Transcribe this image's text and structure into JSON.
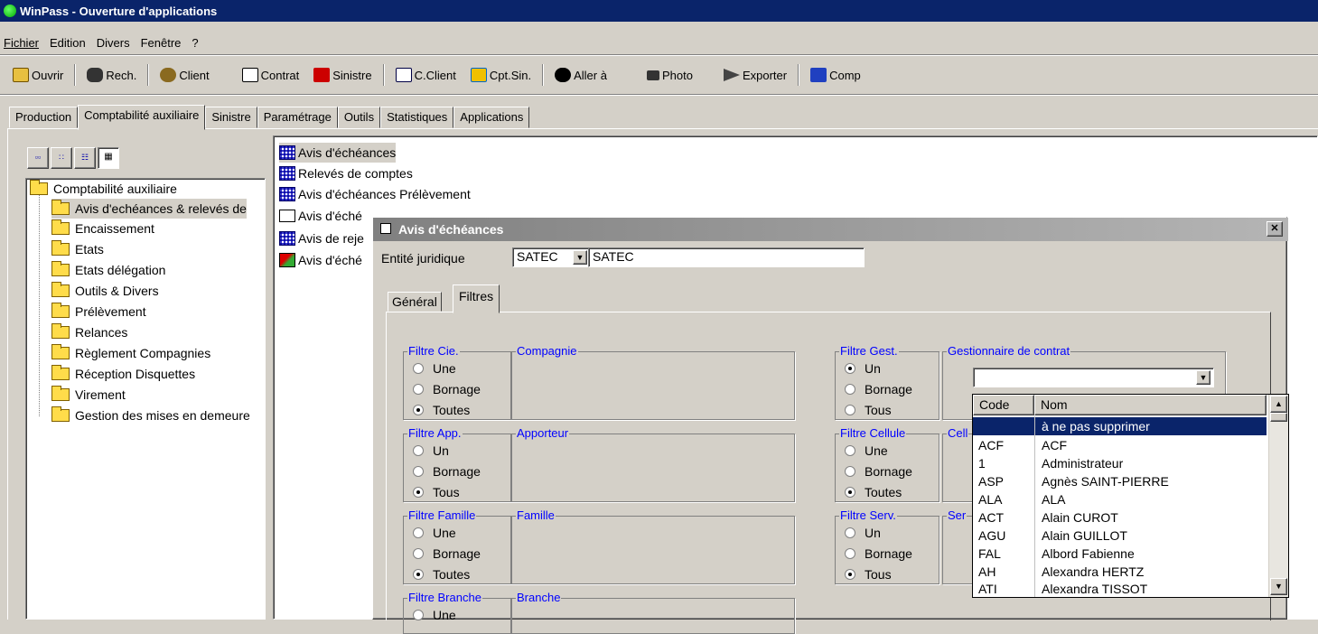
{
  "window": {
    "title": "WinPass - Ouverture d'applications"
  },
  "menu": [
    "Fichier",
    "Edition",
    "Divers",
    "Fenêtre",
    "?"
  ],
  "toolbar": [
    {
      "label": "Ouvrir",
      "icon": "folder-open-icon"
    },
    {
      "label": "Rech.",
      "icon": "binoculars-icon"
    },
    {
      "label": "Client",
      "icon": "client-icon"
    },
    {
      "label": "Contrat",
      "icon": "contract-icon"
    },
    {
      "label": "Sinistre",
      "icon": "car-accident-icon"
    },
    {
      "label": "C.Client",
      "icon": "account-icon"
    },
    {
      "label": "Cpt.Sin.",
      "icon": "claim-account-icon"
    },
    {
      "label": "Aller à",
      "icon": "goto-icon"
    },
    {
      "label": "Photo",
      "icon": "camera-icon"
    },
    {
      "label": "Exporter",
      "icon": "export-icon"
    },
    {
      "label": "Comp",
      "icon": "company-icon"
    }
  ],
  "tabs": [
    "Production",
    "Comptabilité auxiliaire",
    "Sinistre",
    "Paramétrage",
    "Outils",
    "Statistiques",
    "Applications"
  ],
  "active_tab": "Comptabilité auxiliaire",
  "tree": {
    "root": "Comptabilité auxiliaire",
    "items": [
      "Avis d'echéances & relevés de",
      "Encaissement",
      "Etats",
      "Etats délégation",
      "Outils & Divers",
      "Prélèvement",
      "Relances",
      "Règlement Compagnies",
      "Réception Disquettes",
      "Virement",
      "Gestion des mises en demeure"
    ]
  },
  "list": [
    "Avis d'échéances",
    "Relevés de comptes",
    "Avis d'échéances Prélèvement",
    "Avis d'éché",
    "Avis de reje",
    "Avis d'éché"
  ],
  "dialog": {
    "title": "Avis d'échéances",
    "close": "✕",
    "entity_label": "Entité juridique",
    "entity_code": "SATEC",
    "entity_name": "SATEC",
    "tabs": [
      "Général",
      "Filtres"
    ],
    "left_groups": [
      {
        "legend": "Filtre Cie.",
        "box": "Compagnie",
        "options": [
          "Une",
          "Bornage",
          "Toutes"
        ],
        "selected": 2
      },
      {
        "legend": "Filtre App.",
        "box": "Apporteur",
        "options": [
          "Un",
          "Bornage",
          "Tous"
        ],
        "selected": 2
      },
      {
        "legend": "Filtre Famille",
        "box": "Famille",
        "options": [
          "Une",
          "Bornage",
          "Toutes"
        ],
        "selected": 2
      },
      {
        "legend": "Filtre Branche",
        "box": "Branche",
        "options": [
          "Une"
        ],
        "selected": -1
      }
    ],
    "right_groups": [
      {
        "legend": "Filtre Gest.",
        "box": "Gestionnaire de contrat",
        "options": [
          "Un",
          "Bornage",
          "Tous"
        ],
        "selected": 0
      },
      {
        "legend": "Filtre Cellule",
        "box": "Cell",
        "options": [
          "Une",
          "Bornage",
          "Toutes"
        ],
        "selected": 2
      },
      {
        "legend": "Filtre Serv.",
        "box": "Ser",
        "options": [
          "Un",
          "Bornage",
          "Tous"
        ],
        "selected": 2
      }
    ]
  },
  "dropdown": {
    "headers": [
      "Code",
      "Nom"
    ],
    "rows": [
      {
        "code": "",
        "nom": "à ne pas supprimer"
      },
      {
        "code": "ACF",
        "nom": "ACF"
      },
      {
        "code": "1",
        "nom": "Administrateur"
      },
      {
        "code": "ASP",
        "nom": "Agnès SAINT-PIERRE"
      },
      {
        "code": "ALA",
        "nom": "ALA"
      },
      {
        "code": "ACT",
        "nom": "Alain CUROT"
      },
      {
        "code": "AGU",
        "nom": "Alain GUILLOT"
      },
      {
        "code": "FAL",
        "nom": "Albord Fabienne"
      },
      {
        "code": "AH",
        "nom": "Alexandra HERTZ"
      },
      {
        "code": "ATI",
        "nom": "Alexandra TISSOT"
      }
    ],
    "selected": 0
  }
}
